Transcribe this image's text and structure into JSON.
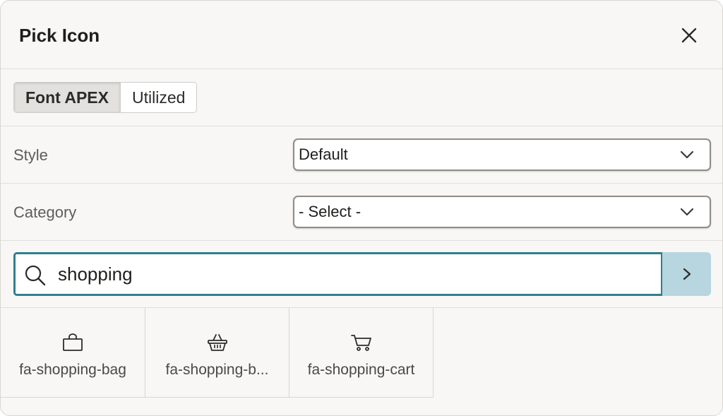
{
  "dialog": {
    "title": "Pick Icon",
    "close_icon": "close-icon"
  },
  "tabs": [
    {
      "label": "Font APEX",
      "active": true
    },
    {
      "label": "Utilized",
      "active": false
    }
  ],
  "style": {
    "label": "Style",
    "value": "Default"
  },
  "category": {
    "label": "Category",
    "value": "- Select -"
  },
  "search": {
    "value": "shopping",
    "icon": "search-icon",
    "go_icon": "chevron-right-icon"
  },
  "results": [
    {
      "label": "fa-shopping-bag",
      "icon": "shopping-bag-icon"
    },
    {
      "label": "fa-shopping-b...",
      "icon": "shopping-basket-icon"
    },
    {
      "label": "fa-shopping-cart",
      "icon": "shopping-cart-icon"
    }
  ],
  "colors": {
    "accent_border": "#2f7f8f",
    "search_button": "#b7d6df",
    "dialog_bg": "#f8f7f5"
  }
}
